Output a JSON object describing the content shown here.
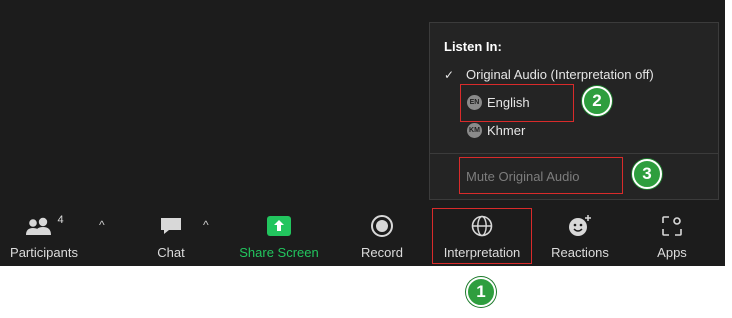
{
  "popup": {
    "heading": "Listen In:",
    "original_audio": "Original Audio (Interpretation off)",
    "languages": [
      {
        "code": "EN",
        "label": "English"
      },
      {
        "code": "KM",
        "label": "Khmer"
      }
    ],
    "mute_label": "Mute Original Audio"
  },
  "toolbar": {
    "participants": {
      "label": "Participants",
      "count": "4",
      "icon": "participants-icon"
    },
    "chat": {
      "label": "Chat",
      "icon": "chat-bubble-icon"
    },
    "share_screen": {
      "label": "Share Screen",
      "icon": "share-screen-icon"
    },
    "record": {
      "label": "Record",
      "icon": "record-icon"
    },
    "interpretation": {
      "label": "Interpretation",
      "icon": "globe-icon"
    },
    "reactions": {
      "label": "Reactions",
      "icon": "emoji-plus-icon"
    },
    "apps": {
      "label": "Apps",
      "icon": "apps-icon"
    }
  },
  "annotations": {
    "step1": "1",
    "step2": "2",
    "step3": "3"
  },
  "colors": {
    "toolbar_bg": "#1c1c1c",
    "popup_bg": "#242424",
    "share_green": "#22c55e",
    "highlight_red": "#d92b2b",
    "badge_green": "#2e9e3e"
  }
}
